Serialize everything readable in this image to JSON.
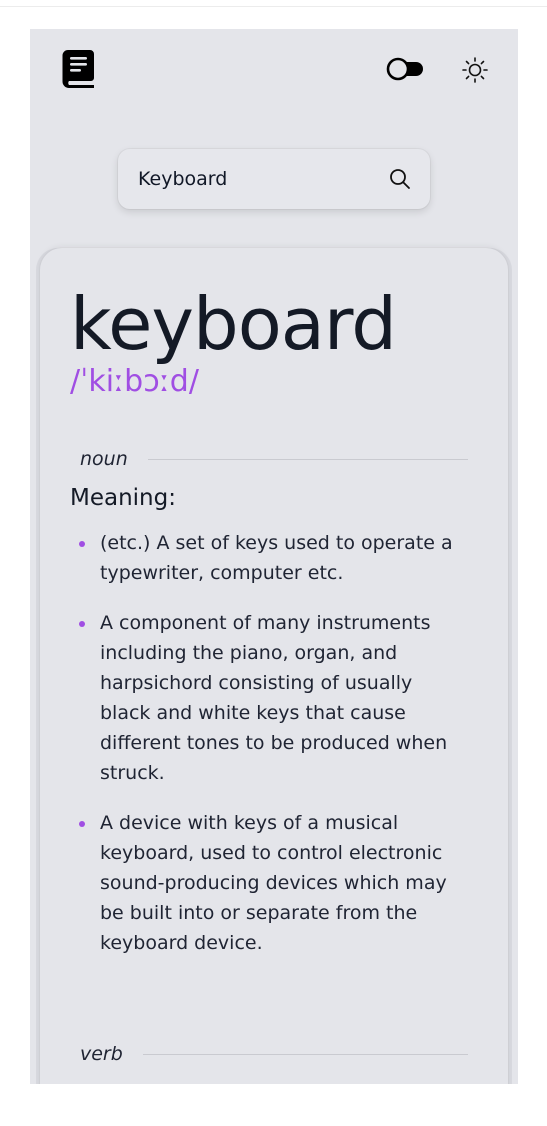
{
  "colors": {
    "accent": "#a04ee3",
    "background": "#e4e5ea",
    "text": "#141a26"
  },
  "header": {
    "logo_icon": "book-icon",
    "theme_toggle_icon": "toggle-icon",
    "theme_icon": "sun-icon"
  },
  "search": {
    "value": "Keyboard",
    "placeholder": "",
    "icon": "search-icon"
  },
  "entry": {
    "word": "keyboard",
    "phonetic": "/ˈkiːbɔːd/",
    "meanings": [
      {
        "part_of_speech": "noun",
        "meaning_label": "Meaning:",
        "definitions": [
          "(etc.) A set of keys used to operate a typewriter, computer etc.",
          "A component of many instruments including the piano, organ, and harpsichord consisting of usually black and white keys that cause different tones to be produced when struck.",
          "A device with keys of a musical keyboard, used to control electronic sound-producing devices which may be built into or separate from the keyboard device."
        ]
      },
      {
        "part_of_speech": "verb"
      }
    ]
  }
}
